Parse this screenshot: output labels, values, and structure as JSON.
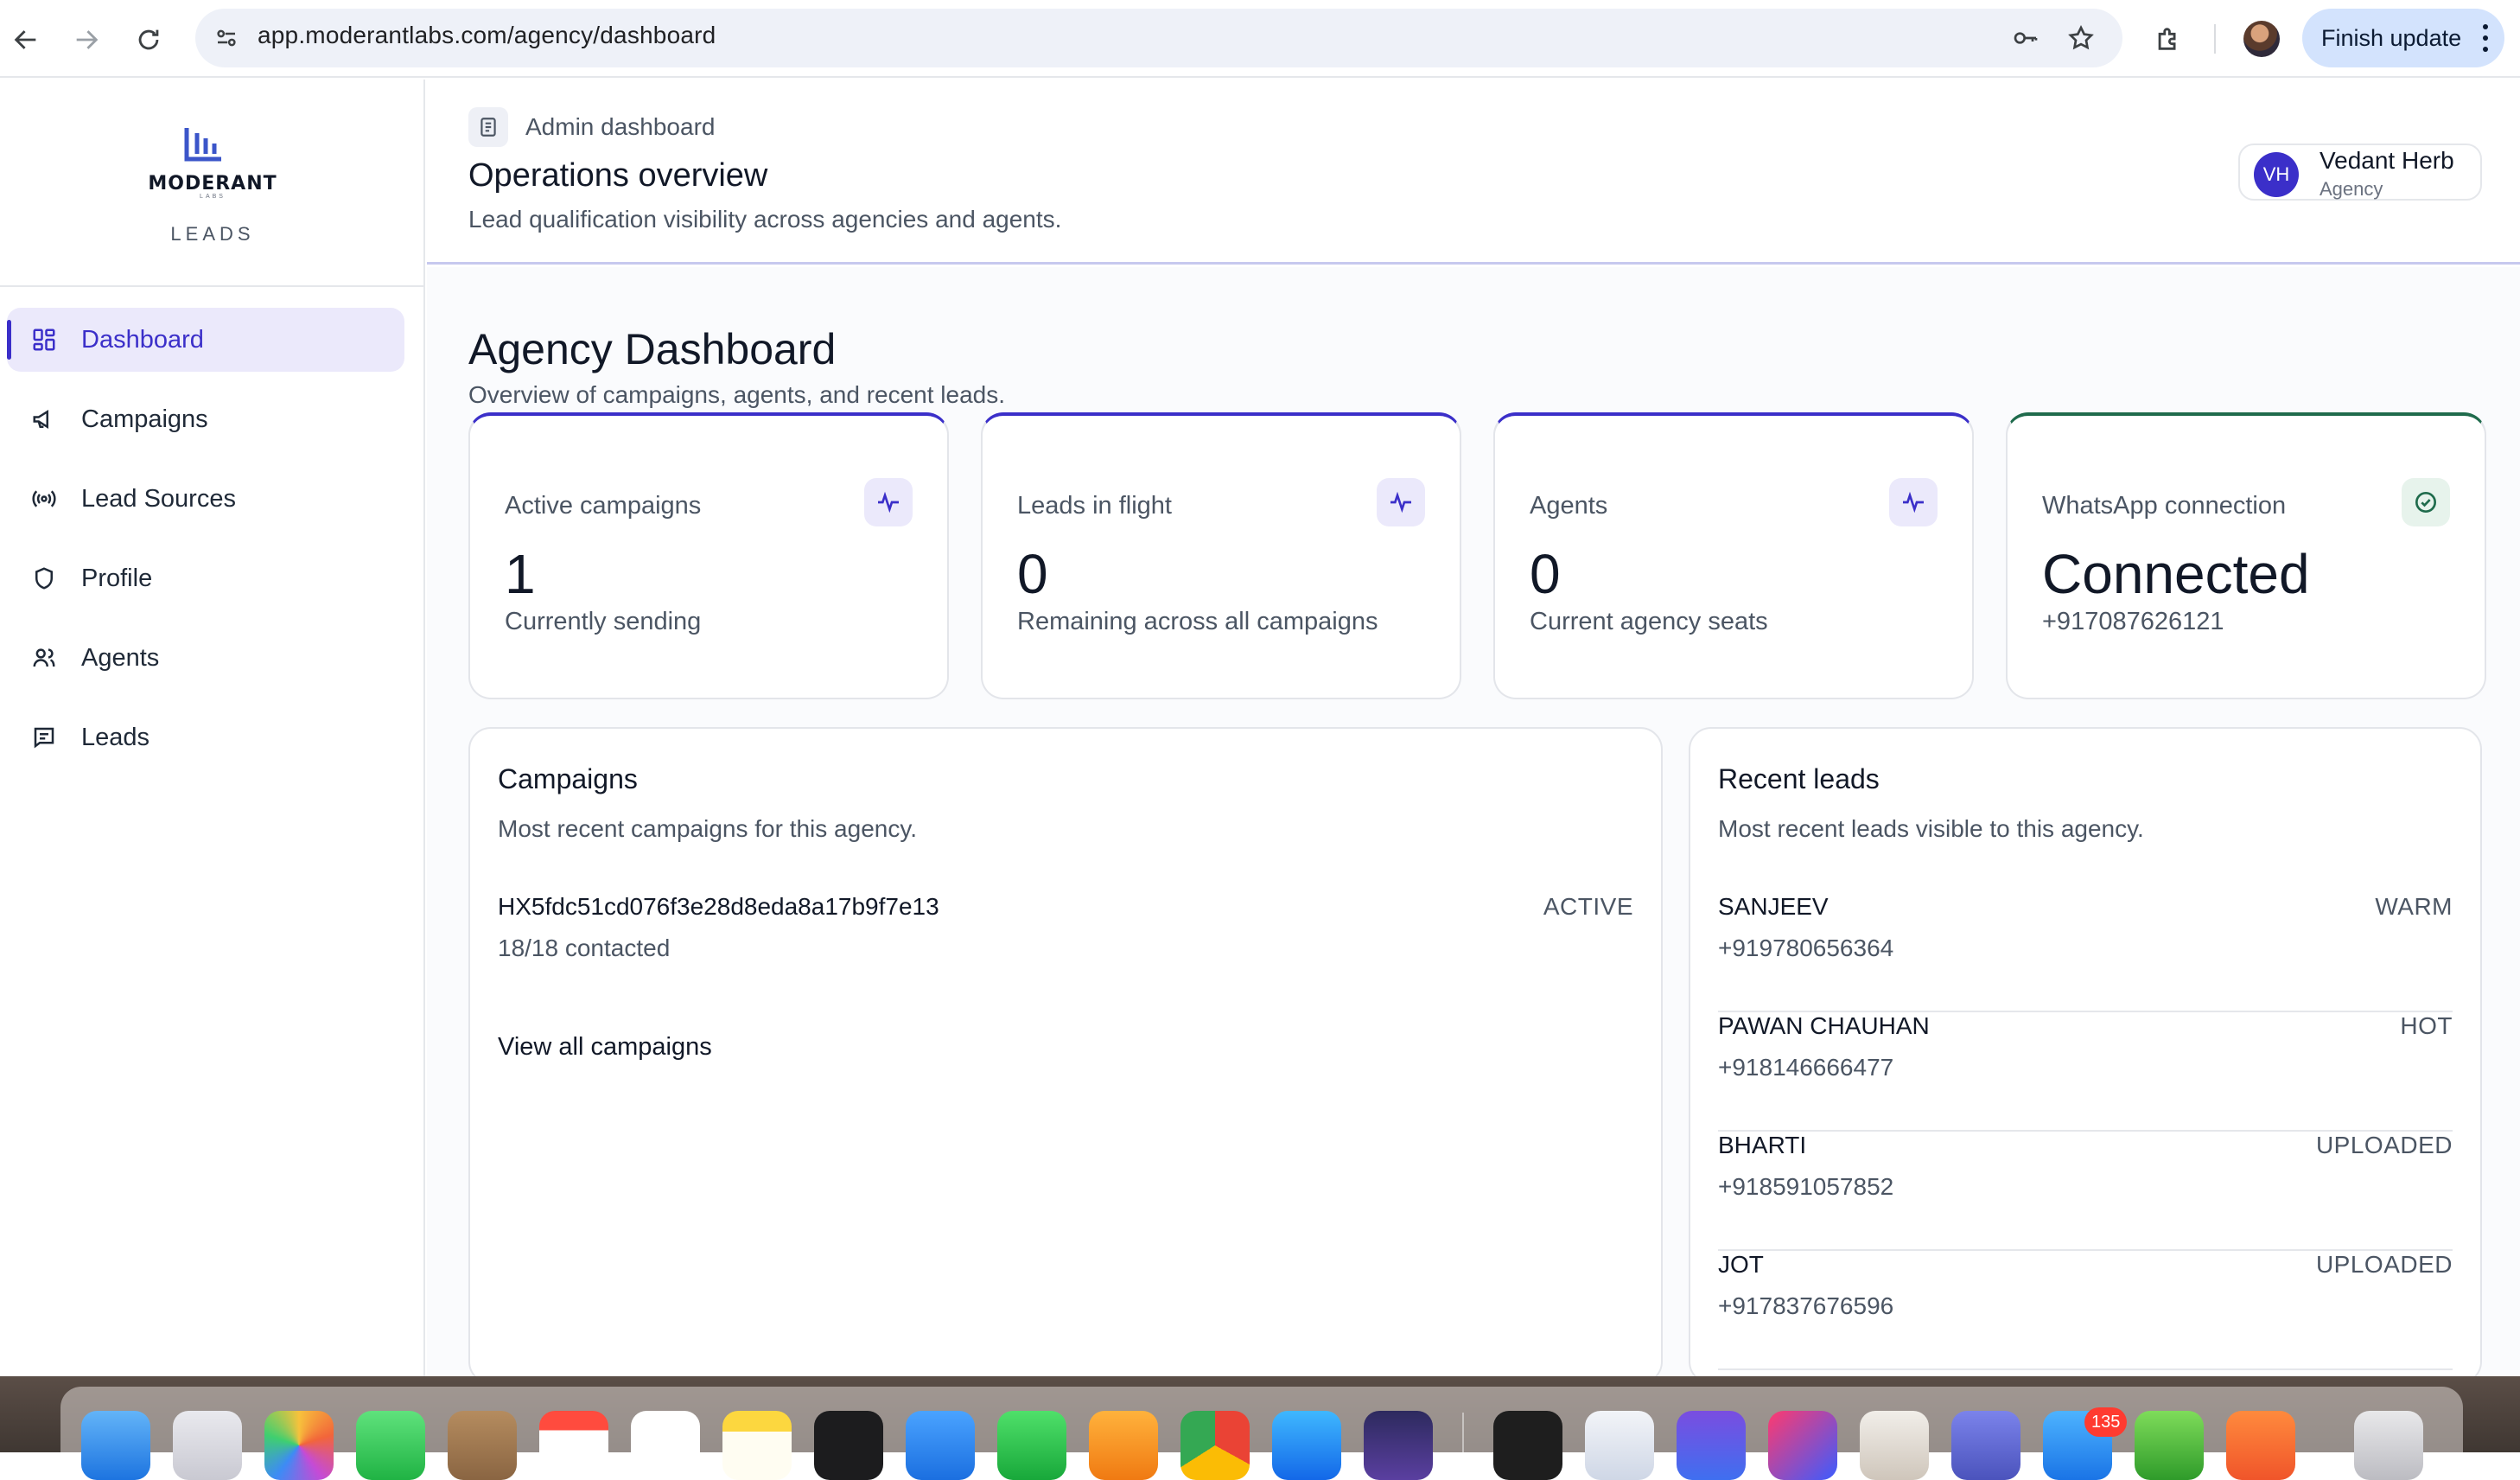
{
  "browser": {
    "url": "app.moderantlabs.com/agency/dashboard",
    "finish_update_label": "Finish update"
  },
  "brand": {
    "logo_text": "MODERANT",
    "logo_sub": "LABS",
    "product_label": "LEADS"
  },
  "sidebar": {
    "items": [
      {
        "label": "Dashboard",
        "icon": "grid-icon",
        "active": true
      },
      {
        "label": "Campaigns",
        "icon": "megaphone-icon",
        "active": false
      },
      {
        "label": "Lead Sources",
        "icon": "broadcast-icon",
        "active": false
      },
      {
        "label": "Profile",
        "icon": "shield-icon",
        "active": false
      },
      {
        "label": "Agents",
        "icon": "users-icon",
        "active": false
      },
      {
        "label": "Leads",
        "icon": "message-icon",
        "active": false
      }
    ]
  },
  "header": {
    "breadcrumb": "Admin dashboard",
    "title": "Operations overview",
    "subtitle": "Lead qualification visibility across agencies and agents.",
    "user": {
      "initials": "VH",
      "name": "Vedant Herb",
      "role": "Agency"
    }
  },
  "dashboard": {
    "title": "Agency Dashboard",
    "subtitle": "Overview of campaigns, agents, and recent leads.",
    "stats": [
      {
        "label": "Active campaigns",
        "value": "1",
        "note": "Currently sending",
        "icon": "activity-icon"
      },
      {
        "label": "Leads in flight",
        "value": "0",
        "note": "Remaining across all campaigns",
        "icon": "activity-icon"
      },
      {
        "label": "Agents",
        "value": "0",
        "note": "Current agency seats",
        "icon": "activity-icon"
      },
      {
        "label": "WhatsApp connection",
        "value": "Connected",
        "note": "+917087626121",
        "icon": "check-circle-icon"
      }
    ]
  },
  "campaigns": {
    "title": "Campaigns",
    "subtitle": "Most recent campaigns for this agency.",
    "items": [
      {
        "name": "HX5fdc51cd076f3e28d8eda8a17b9f7e13",
        "status": "ACTIVE",
        "progress": "18/18 contacted"
      }
    ],
    "view_all_label": "View all campaigns"
  },
  "recent_leads": {
    "title": "Recent leads",
    "subtitle": "Most recent leads visible to this agency.",
    "items": [
      {
        "name": "SANJEEV",
        "phone": "+919780656364",
        "status": "WARM"
      },
      {
        "name": "PAWAN CHAUHAN",
        "phone": "+918146666477",
        "status": "HOT"
      },
      {
        "name": "BHARTI",
        "phone": "+918591057852",
        "status": "UPLOADED"
      },
      {
        "name": "JOT",
        "phone": "+917837676596",
        "status": "UPLOADED"
      }
    ]
  },
  "dock": {
    "mail_badge": "135"
  },
  "colors": {
    "accent": "#3b2fc9",
    "accent_soft": "#ebe9fb",
    "success": "#1f6b4c"
  }
}
